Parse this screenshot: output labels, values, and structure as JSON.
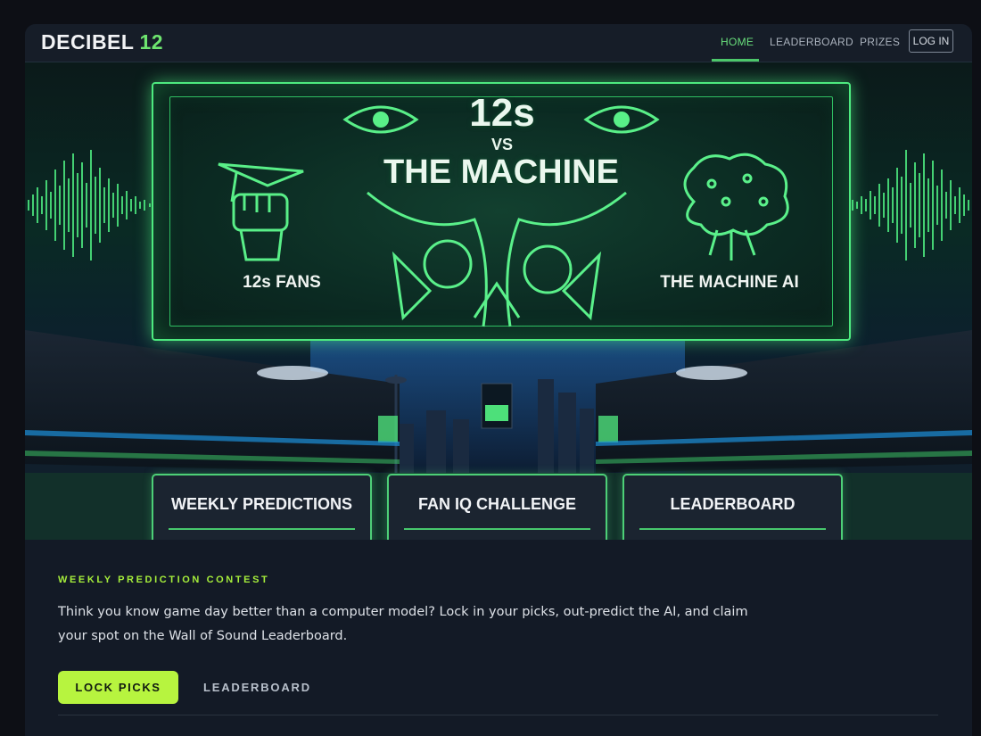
{
  "nav": {
    "brand": "DECIBEL",
    "brand_number": "12",
    "links": [
      {
        "label": "HOME",
        "active": true
      },
      {
        "label": "LEADERBOARD",
        "active": false
      },
      {
        "label": "PRIZES",
        "active": false
      }
    ],
    "login_label": "LOG IN"
  },
  "hero": {
    "title_top": "12s",
    "title_vs": "VS",
    "title_bottom": "THE MACHINE",
    "left_label": "12s FANS",
    "right_label": "THE MACHINE AI"
  },
  "cards": [
    {
      "title": "WEEKLY PREDICTIONS"
    },
    {
      "title": "FAN IQ CHALLENGE"
    },
    {
      "title": "LEADERBOARD"
    }
  ],
  "contest": {
    "eyebrow": "WEEKLY PREDICTION CONTEST",
    "description": "Think you know game day better than a computer model? Lock in your picks, out-predict the AI, and claim your spot on the Wall of Sound Leaderboard.",
    "primary_button": "LOCK PICKS",
    "secondary_button": "LEADERBOARD"
  },
  "colors": {
    "accent_green": "#4dea7f",
    "button_lime": "#b7f43f",
    "eyebrow_lime": "#a6ee3b"
  }
}
